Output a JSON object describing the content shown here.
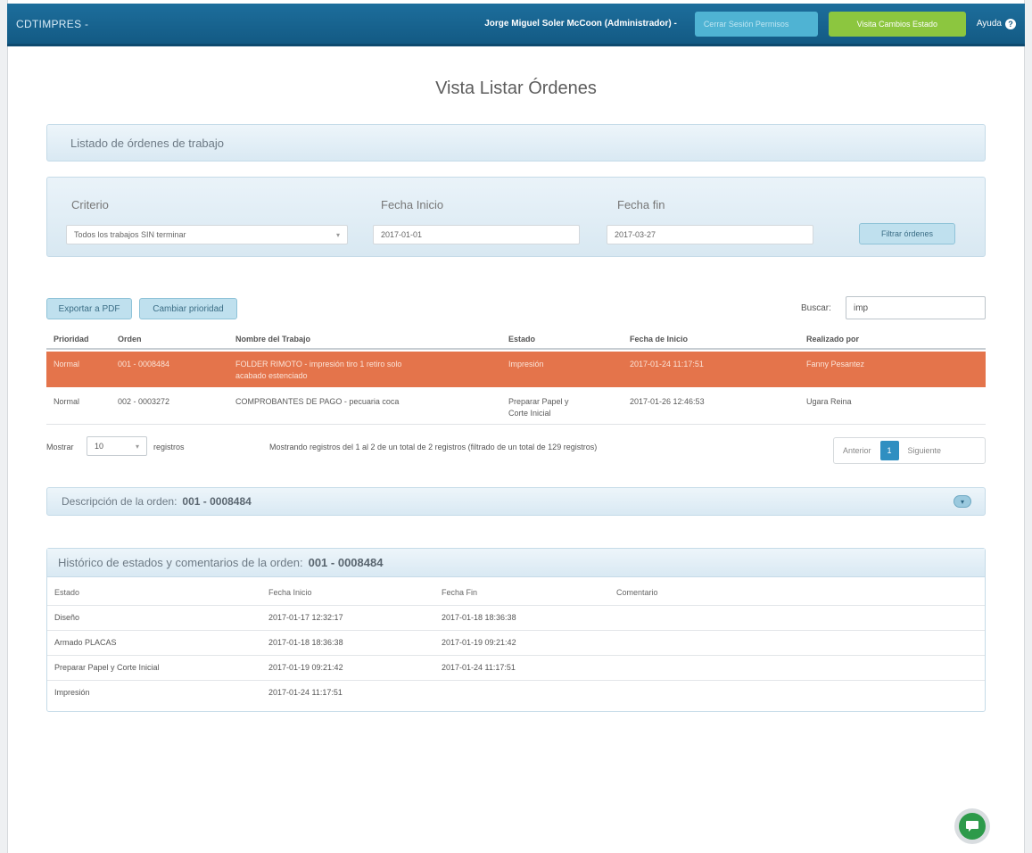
{
  "navbar": {
    "brand": "CDTIMPRES -",
    "user": "Jorge Miguel Soler McCoon (Administrador) -",
    "btn_blue": "Cerrar Sesión Permisos",
    "btn_green": "Visita Cambios Estado",
    "help": "Ayuda"
  },
  "page_title": "Vista Listar Órdenes",
  "list_panel_title": "Listado de órdenes de trabajo",
  "filter": {
    "criterio_label": "Criterio",
    "criterio_value": "Todos los trabajos SIN terminar",
    "fecha_inicio_label": "Fecha Inicio",
    "fecha_inicio_value": "2017-01-01",
    "fecha_fin_label": "Fecha fin",
    "fecha_fin_value": "2017-03-27",
    "button": "Filtrar órdenes"
  },
  "toolbar": {
    "export_pdf": "Exportar a PDF",
    "change_priority": "Cambiar prioridad",
    "search_label": "Buscar:",
    "search_value": "imp"
  },
  "table": {
    "headers": [
      "Prioridad",
      "Orden",
      "Nombre del Trabajo",
      "Estado",
      "Fecha de Inicio",
      "Realizado por"
    ],
    "rows": [
      {
        "prioridad": "Normal",
        "orden": "001 - 0008484",
        "nombre": "FOLDER RIMOTO - impresión tiro 1 retiro solo",
        "nombre2": "acabado estenciado",
        "estado": "Impresión",
        "estado2": "",
        "fecha": "2017-01-24 11:17:51",
        "realizado": "Fanny Pesantez"
      },
      {
        "prioridad": "Normal",
        "orden": "002 - 0003272",
        "nombre": "COMPROBANTES DE PAGO - pecuaria coca",
        "nombre2": "",
        "estado": "Preparar Papel y",
        "estado2": "Corte Inicial",
        "fecha": "2017-01-26 12:46:53",
        "realizado": "Ugara Reina"
      }
    ]
  },
  "footer": {
    "show_label": "Mostrar",
    "show_value": "10",
    "records_label": "registros",
    "info": "Mostrando registros del 1 al 2 de un total de 2 registros (filtrado de un total de 129 registros)",
    "prev": "Anterior",
    "page": "1",
    "next": "Siguiente"
  },
  "description": {
    "label": "Descripción de la orden:",
    "order": "001 - 0008484"
  },
  "history": {
    "label": "Histórico de estados y comentarios de la orden:",
    "order": "001 - 0008484",
    "headers": [
      "Estado",
      "Fecha Inicio",
      "Fecha Fin",
      "Comentario"
    ],
    "rows": [
      {
        "estado": "Diseño",
        "inicio": "2017-01-17 12:32:17",
        "fin": "2017-01-18 18:36:38",
        "comentario": ""
      },
      {
        "estado": "Armado PLACAS",
        "inicio": "2017-01-18 18:36:38",
        "fin": "2017-01-19 09:21:42",
        "comentario": ""
      },
      {
        "estado": "Preparar Papel y Corte Inicial",
        "inicio": "2017-01-19 09:21:42",
        "fin": "2017-01-24 11:17:51",
        "comentario": ""
      },
      {
        "estado": "Impresión",
        "inicio": "2017-01-24 11:17:51",
        "fin": "",
        "comentario": ""
      }
    ]
  },
  "colors": {
    "navbar": "#135a84",
    "selected_row": "#e4744b",
    "green_button": "#8cc63f",
    "chat": "#2d9a4a"
  }
}
